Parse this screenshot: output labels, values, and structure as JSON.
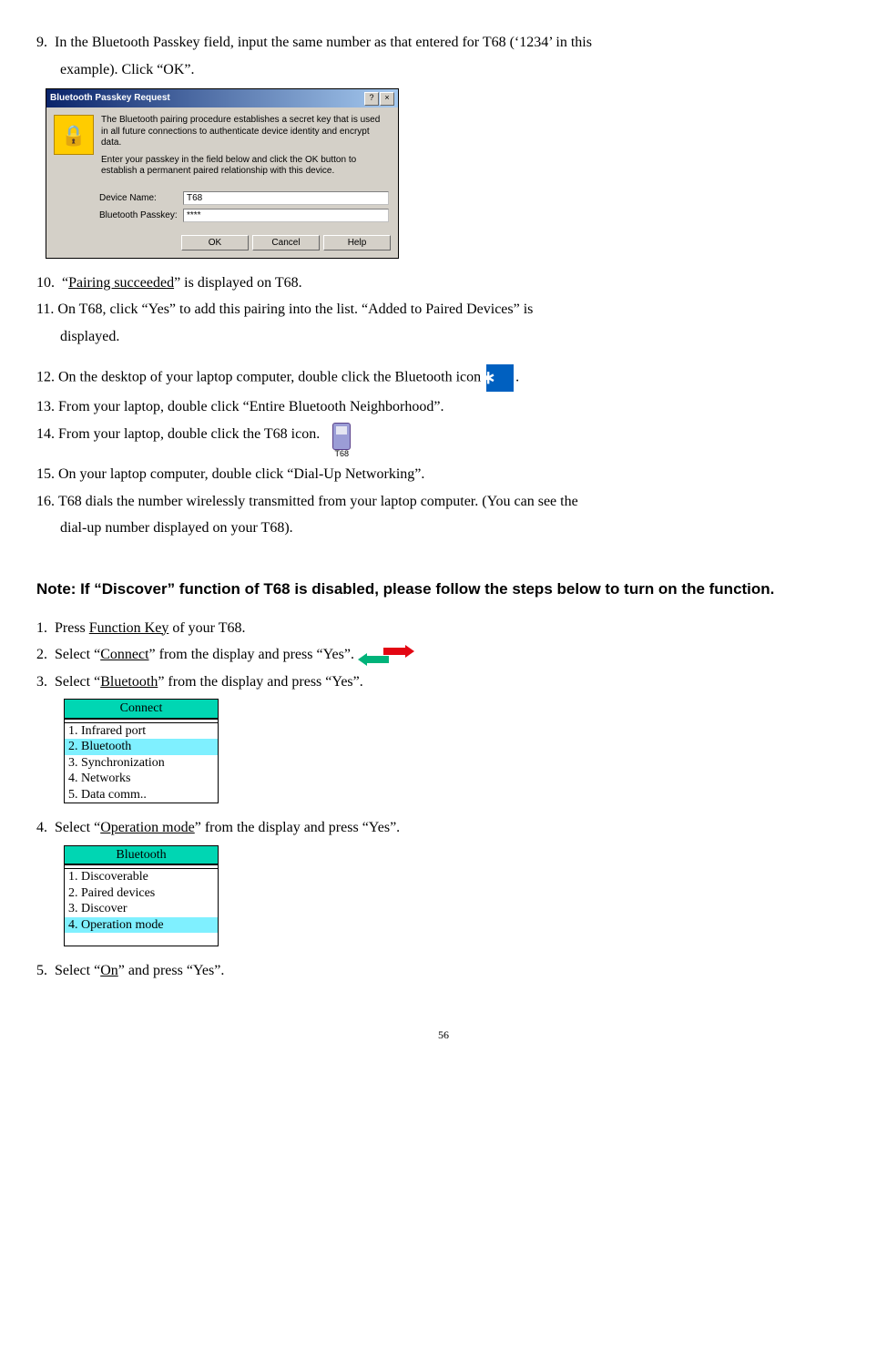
{
  "step9_a": "In the Bluetooth Passkey field, input the same number as that entered for T68 (‘1234’ in this",
  "step9_b": "example).    Click “OK”.",
  "dialog": {
    "title": "Bluetooth Passkey Request",
    "help_btn": "?",
    "close_btn": "×",
    "lock": "🔒",
    "p1": "The Bluetooth pairing procedure establishes a secret key that is used in all future connections to authenticate device identity and encrypt data.",
    "p2": "Enter your passkey in the field below and click the OK button to establish a permanent paired relationship with this device.",
    "label_device": "Device Name:",
    "val_device": "T68",
    "label_passkey": "Bluetooth Passkey:",
    "val_passkey": "****",
    "ok": "OK",
    "cancel": "Cancel",
    "help": "Help"
  },
  "step10_a": "“",
  "step10_u": "Pairing succeeded",
  "step10_b": "” is displayed on T68.",
  "step11_a": "On T68, click “Yes” to add this pairing into the list.    “Added to Paired Devices” is",
  "step11_b": "displayed.",
  "step12": "On the desktop of your laptop computer, double click the Bluetooth icon",
  "step12_end": ".",
  "step13": "From your laptop, double click “Entire Bluetooth Neighborhood”.",
  "step14": "From your laptop, double click the T68 icon.",
  "t68_label": "T68",
  "step15": "On your laptop computer, double click “Dial-Up Networking”.",
  "step16_a": "T68 dials the number wirelessly transmitted from your laptop computer.    (You can see the",
  "step16_b": "dial-up number displayed on your T68).",
  "note": "Note: If “Discover” function of T68 is disabled, please follow the steps below to turn on the function.",
  "n1_a": "Press ",
  "n1_u": "Function Key",
  "n1_b": " of your T68.",
  "n2_a": "Select “",
  "n2_u": "Connect",
  "n2_b": "” from the display and press “Yes”.",
  "n3_a": "Select “",
  "n3_u": "Bluetooth",
  "n3_b": "” from the display and press “Yes”.",
  "menu1": {
    "title": "Connect",
    "i1": "1. Infrared port",
    "i2": "2. Bluetooth",
    "i3": "3. Synchronization",
    "i4": "4. Networks",
    "i5": "5. Data comm.."
  },
  "n4_a": "Select “",
  "n4_u": "Operation mode",
  "n4_b": "” from the display and press “Yes”.",
  "menu2": {
    "title": "Bluetooth",
    "i1": "1. Discoverable",
    "i2": "2. Paired devices",
    "i3": "3. Discover",
    "i4": "4. Operation mode"
  },
  "n5_a": "Select “",
  "n5_u": "On",
  "n5_b": "” and press “Yes”.",
  "page": "56",
  "bt_glyph": "∗"
}
